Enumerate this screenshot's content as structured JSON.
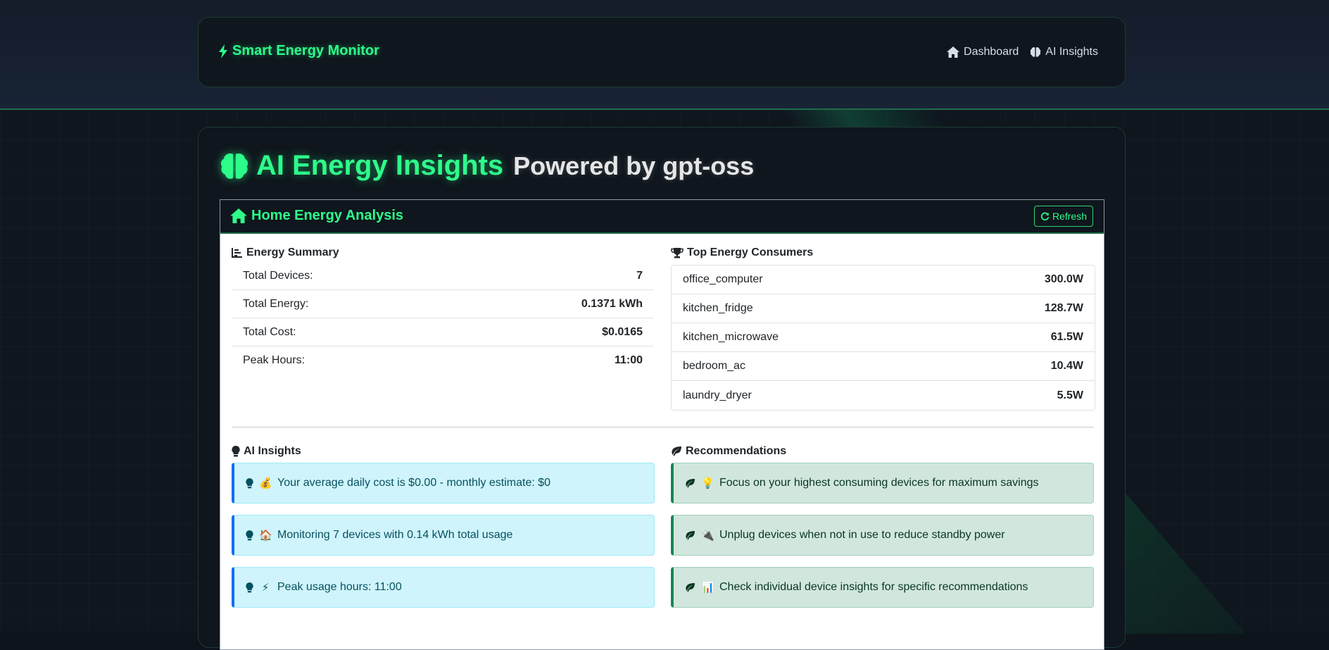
{
  "brand": {
    "title": "Smart Energy Monitor"
  },
  "nav": {
    "links": [
      {
        "label": "Dashboard"
      },
      {
        "label": "AI Insights"
      }
    ]
  },
  "page": {
    "title": "AI Energy Insights",
    "subtitle": "Powered by gpt-oss"
  },
  "panel": {
    "title": "Home Energy Analysis",
    "refresh_label": "Refresh"
  },
  "summary": {
    "title": "Energy Summary",
    "rows": [
      {
        "label": "Total Devices:",
        "value": "7"
      },
      {
        "label": "Total Energy:",
        "value": "0.1371 kWh"
      },
      {
        "label": "Total Cost:",
        "value": "$0.0165"
      },
      {
        "label": "Peak Hours:",
        "value": "11:00"
      }
    ]
  },
  "consumers": {
    "title": "Top Energy Consumers",
    "rows": [
      {
        "name": "office_computer",
        "power": "300.0W"
      },
      {
        "name": "kitchen_fridge",
        "power": "128.7W"
      },
      {
        "name": "kitchen_microwave",
        "power": "61.5W"
      },
      {
        "name": "bedroom_ac",
        "power": "10.4W"
      },
      {
        "name": "laundry_dryer",
        "power": "5.5W"
      }
    ]
  },
  "insights": {
    "title": "AI Insights",
    "items": [
      {
        "emoji": "💰",
        "text": "Your average daily cost is $0.00 - monthly estimate: $0"
      },
      {
        "emoji": "🏠",
        "text": "Monitoring 7 devices with 0.14 kWh total usage"
      },
      {
        "emoji": "⚡",
        "text": "Peak usage hours: 11:00"
      }
    ]
  },
  "recommendations": {
    "title": "Recommendations",
    "items": [
      {
        "emoji": "💡",
        "text": "Focus on your highest consuming devices for maximum savings"
      },
      {
        "emoji": "🔌",
        "text": "Unplug devices when not in use to reduce standby power"
      },
      {
        "emoji": "📊",
        "text": "Check individual device insights for specific recommendations"
      }
    ]
  },
  "colors": {
    "accent": "#2dfc8a",
    "background": "#0f161d",
    "info": "#cff4fc",
    "success": "#d1e7dd"
  },
  "icons": [
    "bolt-icon",
    "home-icon",
    "brain-icon",
    "refresh-icon",
    "chart-icon",
    "trophy-icon",
    "lightbulb-icon",
    "leaf-icon"
  ]
}
